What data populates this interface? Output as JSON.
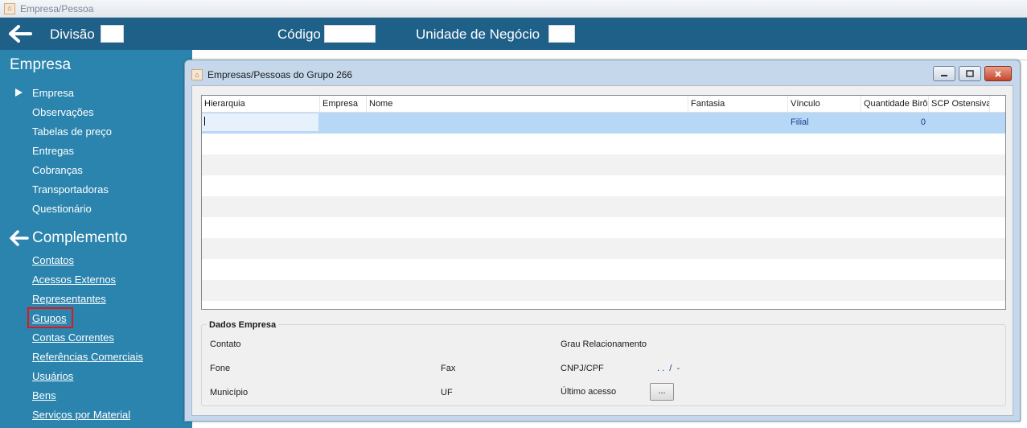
{
  "window": {
    "title": "Empresa/Pessoa"
  },
  "header": {
    "divisao_label": "Divisão",
    "codigo_label": "Código",
    "unidade_label": "Unidade de Negócio"
  },
  "sidebar": {
    "empresa_title": "Empresa",
    "empresa_items": [
      "Empresa",
      "Observações",
      "Tabelas de preço",
      "Entregas",
      "Cobranças",
      "Transportadoras",
      "Questionário"
    ],
    "complemento_title": "Complemento",
    "complemento_items": [
      "Contatos",
      "Acessos Externos",
      "Representantes",
      "Grupos",
      "Contas Correntes",
      "Referências Comerciais",
      "Usuários",
      "Bens",
      "Serviços por Material"
    ]
  },
  "modal": {
    "title": "Empresas/Pessoas do Grupo 266",
    "columns": [
      "Hierarquia",
      "Empresa",
      "Nome",
      "Fantasia",
      "Vínculo",
      "Quantidade Birô",
      "SCP Ostensiva"
    ],
    "rows": [
      {
        "hierarquia": "",
        "empresa": "",
        "nome": "",
        "fantasia": "",
        "vinculo": "Filial",
        "quantidade_biro": "0",
        "scp": ""
      }
    ],
    "dados_empresa": {
      "legend": "Dados Empresa",
      "contato_label": "Contato",
      "grau_label": "Grau Relacionamento",
      "fone_label": "Fone",
      "fax_label": "Fax",
      "cnpj_label": "CNPJ/CPF",
      "cnpj_mask": ". .  /  -",
      "municipio_label": "Município",
      "uf_label": "UF",
      "ultimo_acesso_label": "Último acesso",
      "dots_button": "..."
    }
  },
  "colors": {
    "header": "#1f6089",
    "sidebar": "#2b84ae",
    "selected_row": "#b7d7f7",
    "highlight": "#e01818"
  }
}
